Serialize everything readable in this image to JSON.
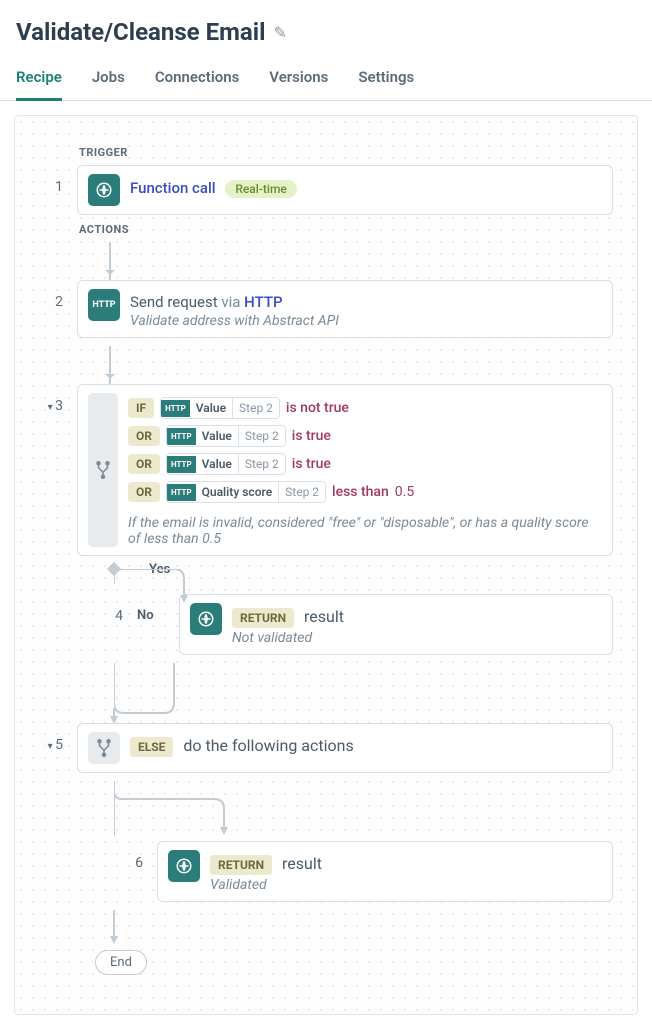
{
  "page": {
    "title": "Validate/Cleanse Email"
  },
  "tabs": [
    "Recipe",
    "Jobs",
    "Connections",
    "Versions",
    "Settings"
  ],
  "labels": {
    "trigger": "TRIGGER",
    "actions": "ACTIONS",
    "end": "End",
    "yes": "Yes",
    "no": "No"
  },
  "steps": {
    "s1": {
      "num": "1",
      "title_prefix": "",
      "link": "Function call",
      "badge": "Real-time"
    },
    "s2": {
      "num": "2",
      "title_prefix": "Send request",
      "via": "via",
      "link": "HTTP",
      "sub": "Validate address with Abstract API"
    },
    "s3": {
      "num": "3",
      "conditions": [
        {
          "kw": "IF",
          "pill_label": "Value",
          "pill_step": "Step 2",
          "op": "is not true"
        },
        {
          "kw": "OR",
          "pill_label": "Value",
          "pill_step": "Step 2",
          "op": "is true"
        },
        {
          "kw": "OR",
          "pill_label": "Value",
          "pill_step": "Step 2",
          "op": "is true"
        },
        {
          "kw": "OR",
          "pill_label": "Quality score",
          "pill_step": "Step 2",
          "op": "less than",
          "val": "0.5"
        }
      ],
      "note": "If the email is invalid, considered \"free\" or \"disposable\", or has a quality score of less than 0.5"
    },
    "s4": {
      "num": "4",
      "tag": "RETURN",
      "result_label": "result",
      "sub": "Not validated"
    },
    "s5": {
      "num": "5",
      "tag": "ELSE",
      "text": "do the following actions"
    },
    "s6": {
      "num": "6",
      "tag": "RETURN",
      "result_label": "result",
      "sub": "Validated"
    }
  }
}
